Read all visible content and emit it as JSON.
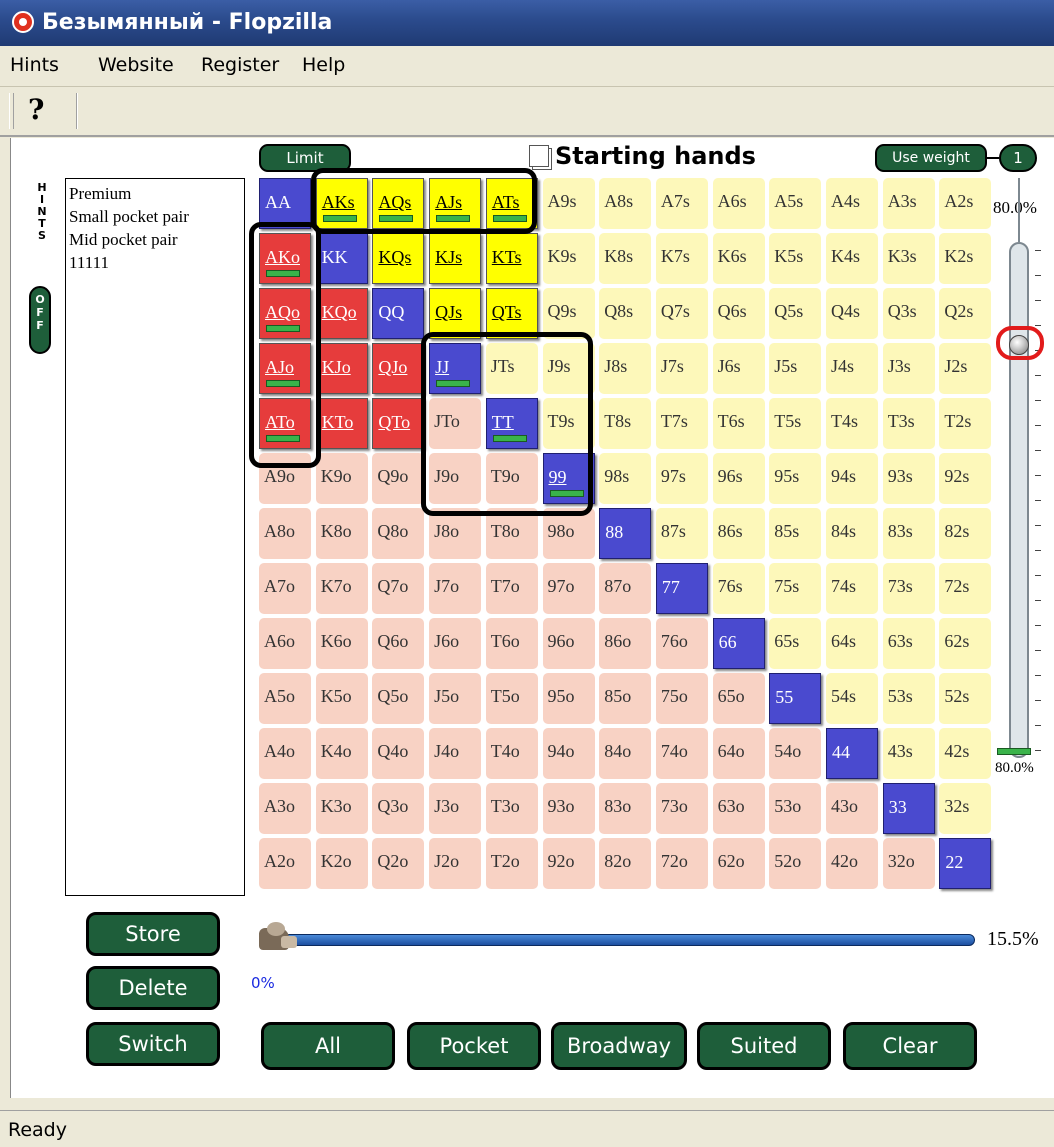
{
  "window": {
    "title": "Безымянный - Flopzilla"
  },
  "menu": [
    "Hints",
    "Website",
    "Register",
    "Help"
  ],
  "toolbar": {
    "help_glyph": "?"
  },
  "hints": {
    "letters": [
      "H",
      "I",
      "N",
      "T",
      "S"
    ],
    "toggle": [
      "O",
      "F",
      "F"
    ]
  },
  "ranges_list": [
    "Premium",
    "Small pocket pair",
    "Mid pocket pair",
    "11111"
  ],
  "header": {
    "limit": "Limit",
    "title": "Starting hands",
    "use_weight": "Use weight",
    "weight_number": "1"
  },
  "colors": {
    "suited": "#fdf8ba",
    "offsuit": "#f8d2c4",
    "pair": "#4a4acf",
    "suited_selected": "#ffff00",
    "offsuit_selected": "#e63c3c",
    "weight_bar": "#3ab34a",
    "button_green": "#1e5e3a",
    "knob_highlight": "#e21b1b"
  },
  "grid": {
    "rows": [
      [
        "AA",
        "AKs",
        "AQs",
        "AJs",
        "ATs",
        "A9s",
        "A8s",
        "A7s",
        "A6s",
        "A5s",
        "A4s",
        "A3s",
        "A2s"
      ],
      [
        "AKo",
        "KK",
        "KQs",
        "KJs",
        "KTs",
        "K9s",
        "K8s",
        "K7s",
        "K6s",
        "K5s",
        "K4s",
        "K3s",
        "K2s"
      ],
      [
        "AQo",
        "KQo",
        "QQ",
        "QJs",
        "QTs",
        "Q9s",
        "Q8s",
        "Q7s",
        "Q6s",
        "Q5s",
        "Q4s",
        "Q3s",
        "Q2s"
      ],
      [
        "AJo",
        "KJo",
        "QJo",
        "JJ",
        "JTs",
        "J9s",
        "J8s",
        "J7s",
        "J6s",
        "J5s",
        "J4s",
        "J3s",
        "J2s"
      ],
      [
        "ATo",
        "KTo",
        "QTo",
        "JTo",
        "TT",
        "T9s",
        "T8s",
        "T7s",
        "T6s",
        "T5s",
        "T4s",
        "T3s",
        "T2s"
      ],
      [
        "A9o",
        "K9o",
        "Q9o",
        "J9o",
        "T9o",
        "99",
        "98s",
        "97s",
        "96s",
        "95s",
        "94s",
        "93s",
        "92s"
      ],
      [
        "A8o",
        "K8o",
        "Q8o",
        "J8o",
        "T8o",
        "98o",
        "88",
        "87s",
        "86s",
        "85s",
        "84s",
        "83s",
        "82s"
      ],
      [
        "A7o",
        "K7o",
        "Q7o",
        "J7o",
        "T7o",
        "97o",
        "87o",
        "77",
        "76s",
        "75s",
        "74s",
        "73s",
        "72s"
      ],
      [
        "A6o",
        "K6o",
        "Q6o",
        "J6o",
        "T6o",
        "96o",
        "86o",
        "76o",
        "66",
        "65s",
        "64s",
        "63s",
        "62s"
      ],
      [
        "A5o",
        "K5o",
        "Q5o",
        "J5o",
        "T5o",
        "95o",
        "85o",
        "75o",
        "65o",
        "55",
        "54s",
        "53s",
        "52s"
      ],
      [
        "A4o",
        "K4o",
        "Q4o",
        "J4o",
        "T4o",
        "94o",
        "84o",
        "74o",
        "64o",
        "54o",
        "44",
        "43s",
        "42s"
      ],
      [
        "A3o",
        "K3o",
        "Q3o",
        "J3o",
        "T3o",
        "93o",
        "83o",
        "73o",
        "63o",
        "53o",
        "43o",
        "33",
        "32s"
      ],
      [
        "A2o",
        "K2o",
        "Q2o",
        "J2o",
        "T2o",
        "92o",
        "82o",
        "72o",
        "62o",
        "52o",
        "42o",
        "32o",
        "22"
      ]
    ],
    "selected": [
      "AKs",
      "AQs",
      "AJs",
      "ATs",
      "AKo",
      "KQs",
      "KJs",
      "KTs",
      "AQo",
      "KQo",
      "QJs",
      "QTs",
      "AJo",
      "KJo",
      "QJo",
      "JJ",
      "ATo",
      "KTo",
      "QTo",
      "TT",
      "99"
    ],
    "weight_bars": [
      "AKs",
      "AQs",
      "AJs",
      "ATs",
      "AKo",
      "AQo",
      "AJo",
      "ATo",
      "JJ",
      "TT",
      "99"
    ]
  },
  "weight_slider": {
    "top_label": "80.0%",
    "bottom_label": "80.0%",
    "value": 0.8
  },
  "range_slider": {
    "min_label": "0%",
    "value_label": "15.5%"
  },
  "left_buttons": [
    "Store",
    "Delete",
    "Switch"
  ],
  "bottom_buttons": [
    "All",
    "Pocket",
    "Broadway",
    "Suited",
    "Clear"
  ],
  "status": "Ready"
}
